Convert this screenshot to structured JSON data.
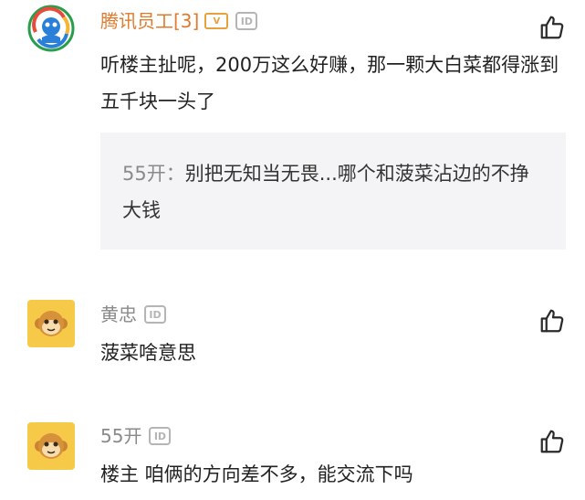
{
  "comments": [
    {
      "username": "腾讯员工[3]",
      "level_badge": "V",
      "id_badge": "ID",
      "avatar_icon": "tencent-news-logo-icon",
      "like_icon": "thumbs-up-icon",
      "text": "听楼主扯呢，200万这么好赚，那一颗大白菜都得涨到五千块一头了",
      "reply": {
        "author": "55开：",
        "text": "别把无知当无畏...哪个和菠菜沾边的不挣大钱"
      }
    },
    {
      "username": "黄忠",
      "id_badge": "ID",
      "avatar_icon": "monkey-avatar-icon",
      "like_icon": "thumbs-up-icon",
      "text": "菠菜啥意思"
    },
    {
      "username": "55开",
      "id_badge": "ID",
      "avatar_icon": "monkey-avatar-icon",
      "like_icon": "thumbs-up-icon",
      "text": "楼主 咱俩的方向差不多，能交流下吗"
    }
  ],
  "colors": {
    "vip_name": "#e07a2c",
    "name": "#8a8a8a",
    "reply_bg": "#f4f4f6",
    "monkey_bg": "#f7c948"
  }
}
